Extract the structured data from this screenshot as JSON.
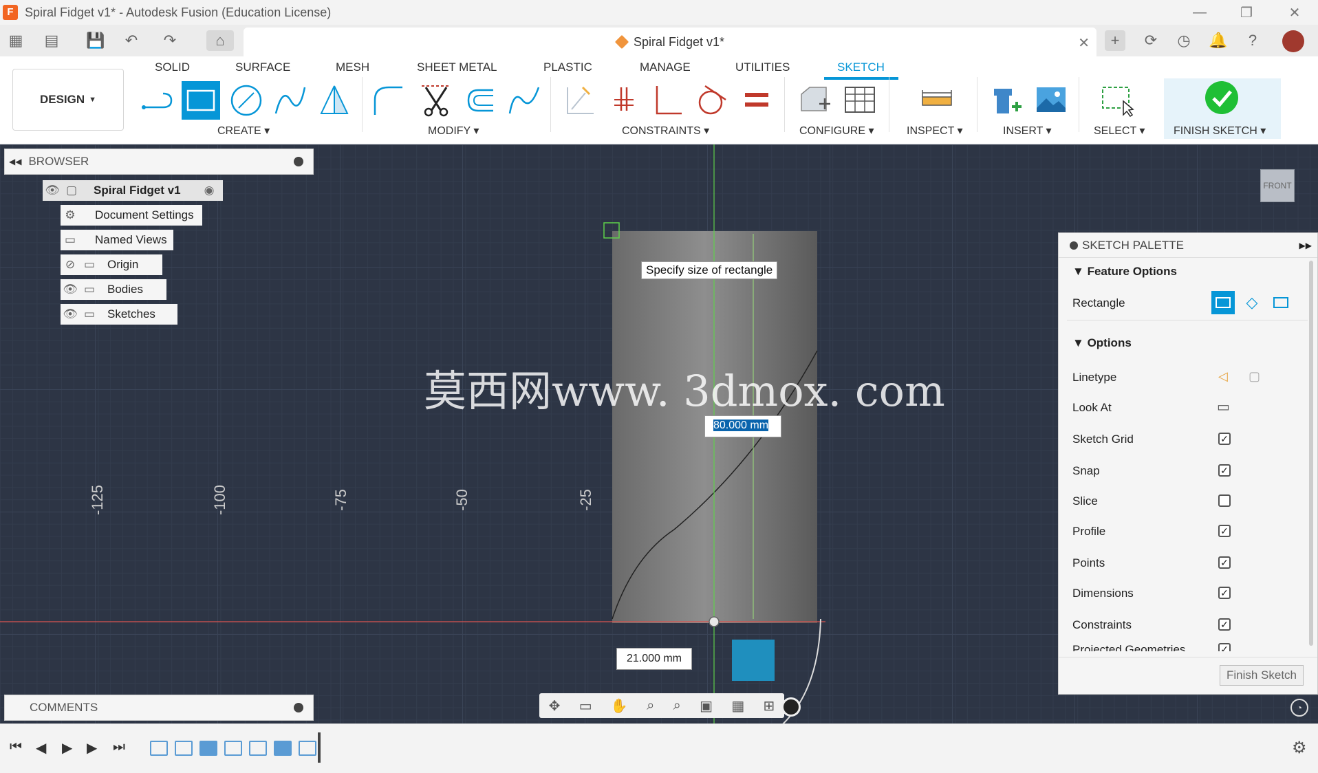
{
  "window": {
    "title": "Spiral Fidget v1* - Autodesk Fusion (Education License)",
    "logo": "F"
  },
  "doc_tab": {
    "title": "Spiral Fidget v1*"
  },
  "workspace": {
    "label": "DESIGN"
  },
  "tabs": [
    "SOLID",
    "SURFACE",
    "MESH",
    "SHEET METAL",
    "PLASTIC",
    "MANAGE",
    "UTILITIES",
    "SKETCH"
  ],
  "groups": {
    "create": "CREATE",
    "modify": "MODIFY",
    "constraints": "CONSTRAINTS",
    "configure": "CONFIGURE",
    "inspect": "INSPECT",
    "insert": "INSERT",
    "select": "SELECT",
    "finish": "FINISH SKETCH"
  },
  "browser": {
    "title": "BROWSER",
    "root": "Spiral Fidget v1",
    "items": [
      "Document Settings",
      "Named Views",
      "Origin",
      "Bodies",
      "Sketches"
    ]
  },
  "comments": {
    "title": "COMMENTS"
  },
  "canvas": {
    "tooltip": "Specify size of rectangle",
    "dim_height": "80.000 mm",
    "dim_width": "21.000 mm",
    "watermark": "莫西网www. 3dmox. com",
    "axis_labels": [
      "-125",
      "-100",
      "-75",
      "-50",
      "-25"
    ],
    "viewcube": "FRONT"
  },
  "palette": {
    "title": "SKETCH PALETTE",
    "feature_options": "Feature Options",
    "rectangle_label": "Rectangle",
    "options": "Options",
    "rows": [
      {
        "label": "Linetype",
        "checked": null
      },
      {
        "label": "Look At",
        "checked": null
      },
      {
        "label": "Sketch Grid",
        "checked": true
      },
      {
        "label": "Snap",
        "checked": true
      },
      {
        "label": "Slice",
        "checked": false
      },
      {
        "label": "Profile",
        "checked": true
      },
      {
        "label": "Points",
        "checked": true
      },
      {
        "label": "Dimensions",
        "checked": true
      },
      {
        "label": "Constraints",
        "checked": true
      },
      {
        "label": "Projected Geometries",
        "checked": true
      }
    ],
    "finish_button": "Finish Sketch"
  },
  "colors": {
    "accent": "#0696d7",
    "canvas_bg": "#2d3545",
    "finish_check": "#1fbf35"
  }
}
